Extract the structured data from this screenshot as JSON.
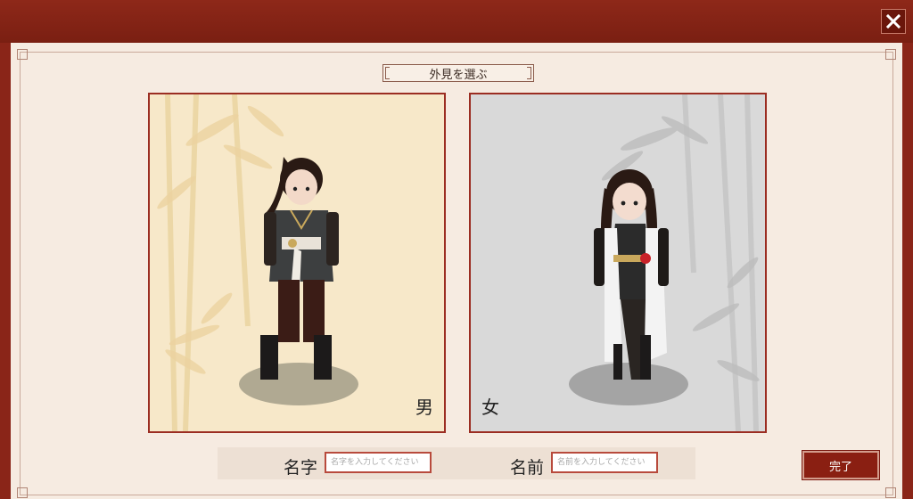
{
  "header": {
    "close_icon": "close-icon"
  },
  "title": "外見を選ぶ",
  "options": [
    {
      "gender_label": "男",
      "theme_color": "#f7e8c9"
    },
    {
      "gender_label": "女",
      "theme_color": "#d9d9d9"
    }
  ],
  "name_form": {
    "surname_label": "名字",
    "surname_placeholder": "名字を入力してください",
    "given_label": "名前",
    "given_placeholder": "名前を入力してください"
  },
  "done_label": "完了",
  "colors": {
    "accent": "#8a1f12",
    "border": "#9b2d22"
  }
}
